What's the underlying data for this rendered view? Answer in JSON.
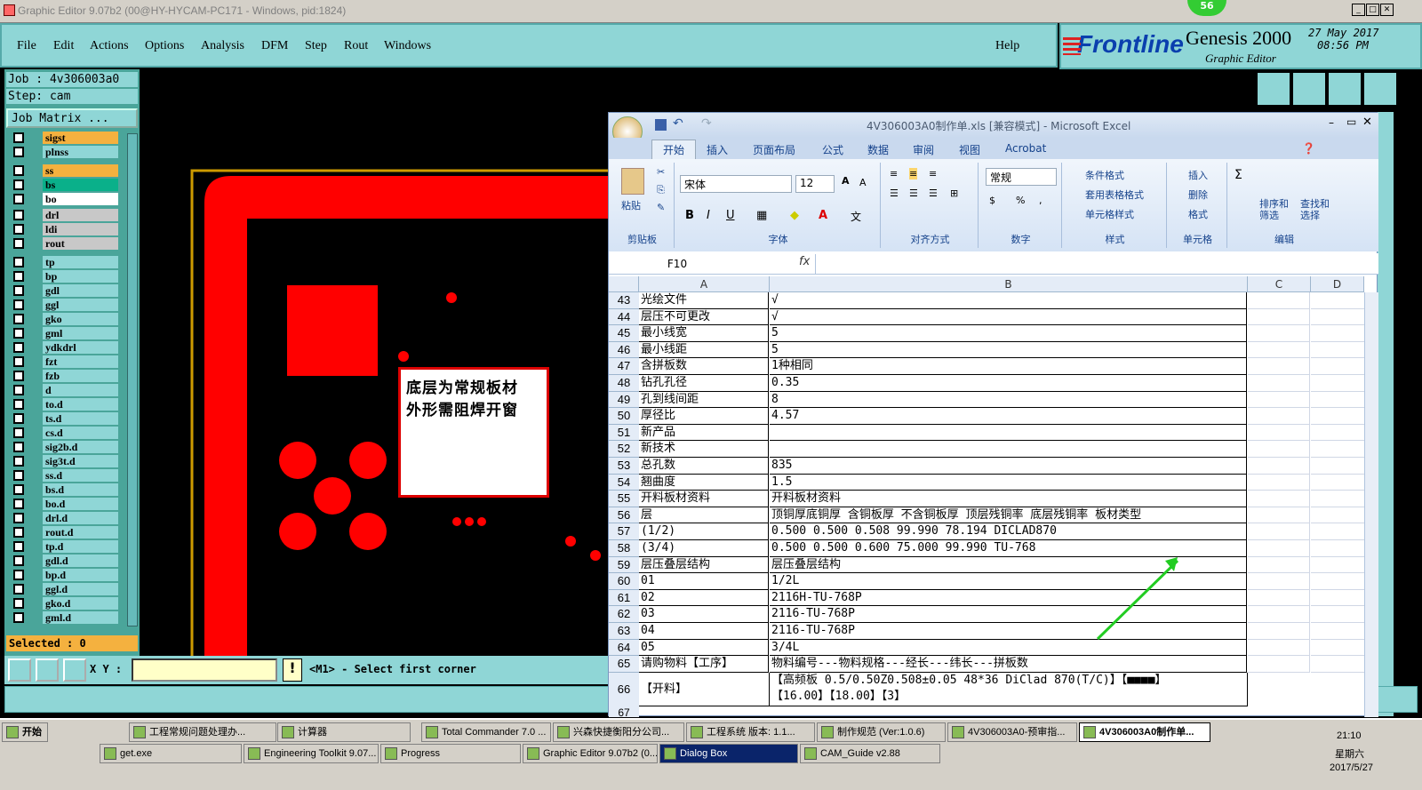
{
  "window": {
    "title": "Graphic Editor 9.07b2 (00@HY-HYCAM-PC171 - Windows, pid:1824)"
  },
  "menu": {
    "items": [
      "File",
      "Edit",
      "Actions",
      "Options",
      "Analysis",
      "DFM",
      "Step",
      "Rout",
      "Windows"
    ],
    "help": "Help"
  },
  "brand": {
    "logo": "Frontline",
    "product": "Genesis 2000",
    "sub": "Graphic Editor",
    "date": "27 May 2017",
    "time": "08:56 PM",
    "badge": "56"
  },
  "job": {
    "job": "Job : 4v306003a0",
    "step": "Step: cam",
    "matrix": "Job Matrix ..."
  },
  "layers": [
    {
      "name": "sigst",
      "color": "#f4b13f"
    },
    {
      "name": "plnss",
      "color": "#8fd6d6"
    },
    {
      "name": "ss",
      "color": "#f4b13f"
    },
    {
      "name": "bs",
      "color": "#0ab08a"
    },
    {
      "name": "bo",
      "color": "#fff"
    },
    {
      "name": "drl",
      "color": "#c8c8c8"
    },
    {
      "name": "ldi",
      "color": "#c8c8c8"
    },
    {
      "name": "rout",
      "color": "#c8c8c8"
    },
    {
      "name": "tp",
      "color": "#8fd6d6"
    },
    {
      "name": "bp",
      "color": "#8fd6d6"
    },
    {
      "name": "gdl",
      "color": "#8fd6d6"
    },
    {
      "name": "ggl",
      "color": "#8fd6d6"
    },
    {
      "name": "gko",
      "color": "#8fd6d6"
    },
    {
      "name": "gml",
      "color": "#8fd6d6"
    },
    {
      "name": "ydkdrl",
      "color": "#8fd6d6"
    },
    {
      "name": "fzt",
      "color": "#8fd6d6"
    },
    {
      "name": "fzb",
      "color": "#8fd6d6"
    },
    {
      "name": "d",
      "color": "#8fd6d6"
    },
    {
      "name": "to.d",
      "color": "#8fd6d6"
    },
    {
      "name": "ts.d",
      "color": "#8fd6d6"
    },
    {
      "name": "cs.d",
      "color": "#8fd6d6"
    },
    {
      "name": "sig2b.d",
      "color": "#8fd6d6"
    },
    {
      "name": "sig3t.d",
      "color": "#8fd6d6"
    },
    {
      "name": "ss.d",
      "color": "#8fd6d6"
    },
    {
      "name": "bs.d",
      "color": "#8fd6d6"
    },
    {
      "name": "bo.d",
      "color": "#8fd6d6"
    },
    {
      "name": "drl.d",
      "color": "#8fd6d6"
    },
    {
      "name": "rout.d",
      "color": "#8fd6d6"
    },
    {
      "name": "tp.d",
      "color": "#8fd6d6"
    },
    {
      "name": "gdl.d",
      "color": "#8fd6d6"
    },
    {
      "name": "bp.d",
      "color": "#8fd6d6"
    },
    {
      "name": "ggl.d",
      "color": "#8fd6d6"
    },
    {
      "name": "gko.d",
      "color": "#8fd6d6"
    },
    {
      "name": "gml.d",
      "color": "#8fd6d6"
    }
  ],
  "selected": "Selected : 0",
  "canvas_note": {
    "line1": "底层为常规板材",
    "line2": "外形需阻焊开窗"
  },
  "bottom": {
    "xy_label": "X Y :",
    "prompt": "<M1> - Select first corner"
  },
  "excel": {
    "title": "4V306003A0制作单.xls [兼容模式] - Microsoft Excel",
    "tabs": [
      "开始",
      "插入",
      "页面布局",
      "公式",
      "数据",
      "审阅",
      "视图",
      "Acrobat"
    ],
    "groups": [
      "剪贴板",
      "字体",
      "对齐方式",
      "数字",
      "样式",
      "单元格",
      "编辑"
    ],
    "paste": "粘贴",
    "font": "宋体",
    "size": "12",
    "numfmt": "常规",
    "styles": [
      "条件格式",
      "套用表格格式",
      "单元格样式"
    ],
    "cells": [
      "插入",
      "删除",
      "格式"
    ],
    "edit": [
      "排序和\n筛选",
      "查找和\n选择"
    ],
    "namebox": "F10",
    "cols": [
      "A",
      "B",
      "C",
      "D"
    ],
    "rows": [
      {
        "n": "43",
        "a": "光绘文件",
        "b": "√"
      },
      {
        "n": "44",
        "a": "层压不可更改",
        "b": "√"
      },
      {
        "n": "45",
        "a": "最小线宽",
        "b": "5"
      },
      {
        "n": "46",
        "a": "最小线距",
        "b": "5"
      },
      {
        "n": "47",
        "a": "含拼板数",
        "b": "1种相同"
      },
      {
        "n": "48",
        "a": "钻孔孔径",
        "b": "0.35"
      },
      {
        "n": "49",
        "a": "孔到线间距",
        "b": "8"
      },
      {
        "n": "50",
        "a": "厚径比",
        "b": "4.57"
      },
      {
        "n": "51",
        "a": "新产品",
        "b": ""
      },
      {
        "n": "52",
        "a": "新技术",
        "b": ""
      },
      {
        "n": "53",
        "a": "总孔数",
        "b": "835"
      },
      {
        "n": "54",
        "a": "翘曲度",
        "b": "1.5"
      },
      {
        "n": "55",
        "a": "开料板材资料",
        "b": "开料板材资料"
      },
      {
        "n": "56",
        "a": "层",
        "b": "顶铜厚底铜厚 含铜板厚 不含铜板厚 顶层残铜率 底层残铜率 板材类型"
      },
      {
        "n": "57",
        "a": "(1/2)",
        "b": "0.500  0.500          0.508     99.990    78.194     DICLAD870"
      },
      {
        "n": "58",
        "a": "(3/4)",
        "b": "0.500  0.500          0.600     75.000    99.990     TU-768"
      },
      {
        "n": "59",
        "a": "层压叠层结构",
        "b": "层压叠层结构"
      },
      {
        "n": "60",
        "a": "01",
        "b": "1/2L"
      },
      {
        "n": "61",
        "a": "02",
        "b": "2116H-TU-768P"
      },
      {
        "n": "62",
        "a": "03",
        "b": "2116-TU-768P"
      },
      {
        "n": "63",
        "a": "04",
        "b": "2116-TU-768P"
      },
      {
        "n": "64",
        "a": "05",
        "b": "3/4L"
      },
      {
        "n": "65",
        "a": "请购物料【工序】",
        "b": "物料编号---物料规格---经长---纬长---拼板数"
      }
    ],
    "row66": {
      "n": "66",
      "a": "【开料】",
      "b1": "【高频板 0.5/0.50Z0.508±0.05 48*36  DiClad 870(T/C)】【■■■■】",
      "b2": "【16.00】【18.00】【3】"
    },
    "row67": "67"
  },
  "taskbar": {
    "start": "开始",
    "row1": [
      "工程常规问题处理办...",
      "计算器",
      "Total Commander 7.0 ...",
      "兴森快捷衡阳分公司...",
      "工程系统  版本: 1.1...",
      "制作规范 (Ver:1.0.6)",
      "4V306003A0-预审指...",
      "4V306003A0制作单..."
    ],
    "row2": [
      "get.exe",
      "Engineering Toolkit 9.07...",
      "Progress",
      "Graphic Editor 9.07b2 (0...",
      "Dialog Box",
      "CAM_Guide v2.88"
    ],
    "time": "21:10",
    "day": "星期六",
    "date": "2017/5/27"
  }
}
